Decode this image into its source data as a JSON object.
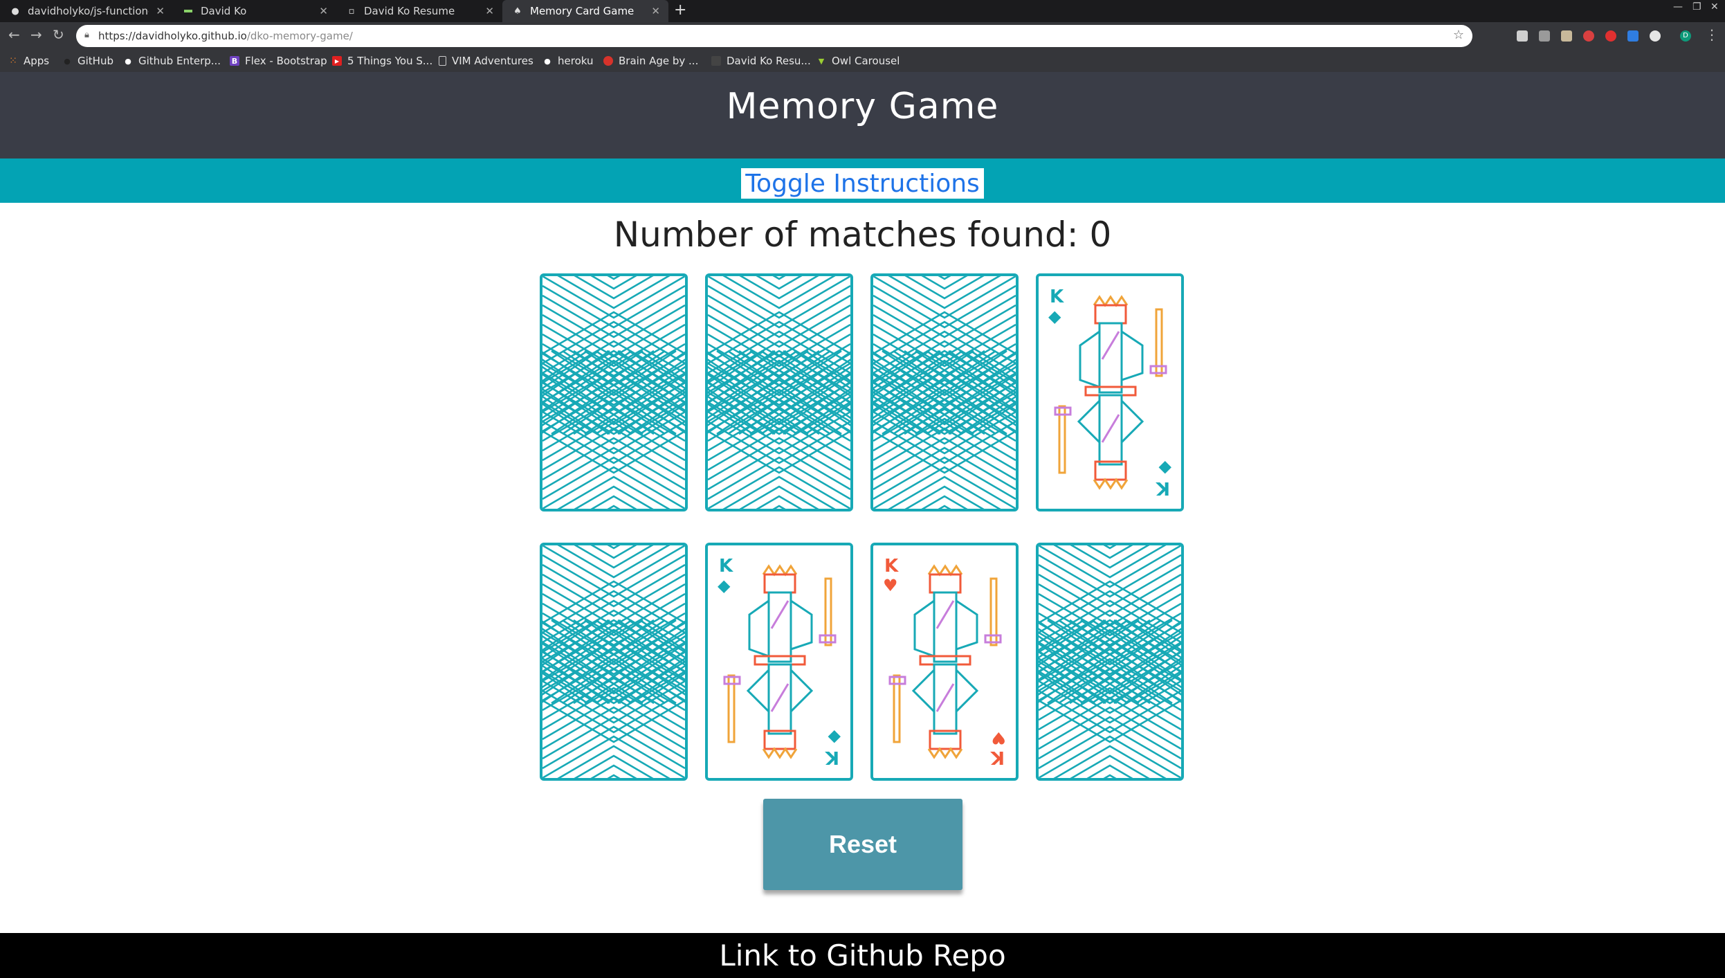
{
  "browser": {
    "tabs": [
      {
        "title": "davidholyko/js-function-c",
        "icon": "github-icon"
      },
      {
        "title": "David Ko",
        "icon": "site-icon"
      },
      {
        "title": "David Ko Resume",
        "icon": "doc-icon"
      },
      {
        "title": "Memory Card Game by Dk",
        "icon": "spade-icon",
        "active": true
      }
    ],
    "url_host": "https://davidholyko.github.io",
    "url_path": "/dko-memory-game/",
    "bookmarks": [
      {
        "label": "Apps",
        "icon": "apps-grid-icon"
      },
      {
        "label": "GitHub",
        "icon": "github-icon"
      },
      {
        "label": "Github Enterp...",
        "icon": "github-icon"
      },
      {
        "label": "Flex - Bootstrap",
        "icon": "bootstrap-icon"
      },
      {
        "label": "5 Things You S...",
        "icon": "youtube-icon"
      },
      {
        "label": "VIM Adventures",
        "icon": "page-icon"
      },
      {
        "label": "heroku",
        "icon": "github-icon"
      },
      {
        "label": "Brain Age by ...",
        "icon": "brain-icon"
      },
      {
        "label": "David Ko Resu...",
        "icon": "doc-icon"
      },
      {
        "label": "Owl Carousel",
        "icon": "owl-icon"
      }
    ]
  },
  "header": {
    "title": "Memory Game"
  },
  "toggle": {
    "label": "Toggle Instructions"
  },
  "status": {
    "text": "Number of matches found: 0"
  },
  "cards": [
    {
      "state": "back"
    },
    {
      "state": "back"
    },
    {
      "state": "back"
    },
    {
      "state": "face",
      "rank": "K",
      "suit": "diamond",
      "suit_symbol": "◆",
      "color": "#17a9b6"
    },
    {
      "state": "back"
    },
    {
      "state": "face",
      "rank": "K",
      "suit": "diamond",
      "suit_symbol": "◆",
      "color": "#17a9b6"
    },
    {
      "state": "face",
      "rank": "K",
      "suit": "heart",
      "suit_symbol": "♥",
      "color": "#f15a3a"
    },
    {
      "state": "back"
    }
  ],
  "reset": {
    "label": "Reset"
  },
  "footer": {
    "link_label": "Link to Github Repo"
  },
  "colors": {
    "header_bg": "#3a3d47",
    "accent": "#03a3b4",
    "card_line": "#17a9b6",
    "reset_bg": "#4d96a8"
  }
}
